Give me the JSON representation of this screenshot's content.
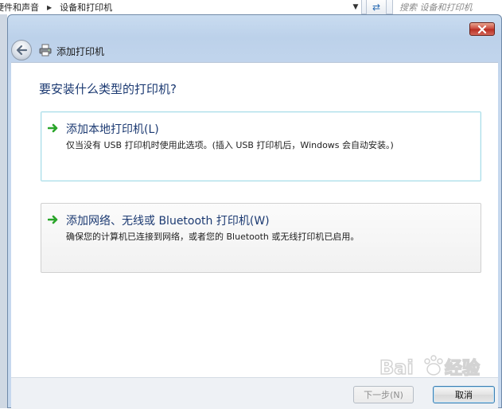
{
  "background_window": {
    "breadcrumb": [
      "硬件和声音",
      "设备和打印机"
    ],
    "search_placeholder": "搜索 设备和打印机"
  },
  "dialog": {
    "nav_title": "添加打印机",
    "heading": "要安装什么类型的打印机?",
    "options": [
      {
        "title": "添加本地打印机(L)",
        "description": "仅当没有 USB 打印机时使用此选项。(插入 USB 打印机后，Windows 会自动安装。)"
      },
      {
        "title": "添加网络、无线或 Bluetooth 打印机(W)",
        "description": "确保您的计算机已连接到网络，或者您的 Bluetooth 或无线打印机已启用。"
      }
    ],
    "buttons": {
      "next": "下一步(N)",
      "cancel": "取消"
    }
  },
  "icons": {
    "back": "back-arrow-icon",
    "printer": "printer-icon",
    "option_arrow": "green-arrow-icon",
    "close": "close-icon",
    "refresh": "refresh-icon"
  },
  "colors": {
    "heading": "#1c3a72",
    "close_button": "#c9463a",
    "option_arrow": "#2aa52a"
  }
}
